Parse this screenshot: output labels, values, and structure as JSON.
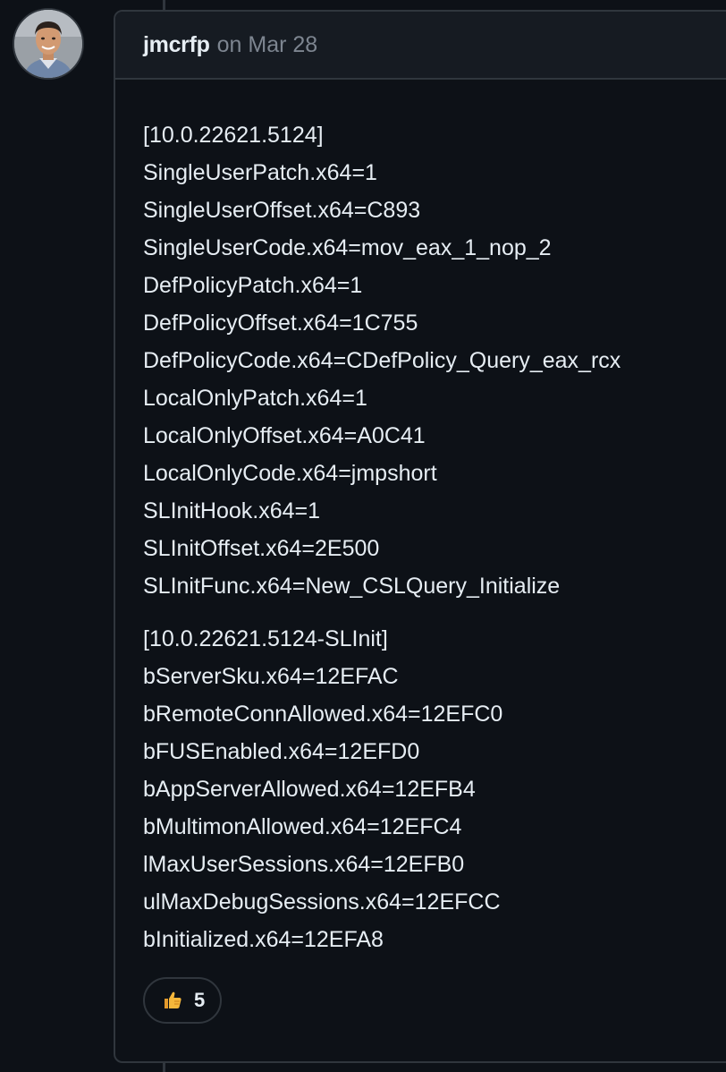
{
  "comment": {
    "author": "jmcrfp",
    "meta": "on Mar 28",
    "avatar_icon": "person-photo-avatar",
    "paragraphs": [
      {
        "lines": [
          "[10.0.22621.5124]",
          "SingleUserPatch.x64=1",
          "SingleUserOffset.x64=C893",
          "SingleUserCode.x64=mov_eax_1_nop_2",
          "DefPolicyPatch.x64=1",
          "DefPolicyOffset.x64=1C755",
          "DefPolicyCode.x64=CDefPolicy_Query_eax_rcx",
          "LocalOnlyPatch.x64=1",
          "LocalOnlyOffset.x64=A0C41",
          "LocalOnlyCode.x64=jmpshort",
          "SLInitHook.x64=1",
          "SLInitOffset.x64=2E500",
          "SLInitFunc.x64=New_CSLQuery_Initialize"
        ]
      },
      {
        "lines": [
          "[10.0.22621.5124-SLInit]",
          "bServerSku.x64=12EFAC",
          "bRemoteConnAllowed.x64=12EFC0",
          "bFUSEnabled.x64=12EFD0",
          "bAppServerAllowed.x64=12EFB4",
          "bMultimonAllowed.x64=12EFC4",
          "lMaxUserSessions.x64=12EFB0",
          "ulMaxDebugSessions.x64=12EFCC",
          "bInitialized.x64=12EFA8"
        ]
      }
    ],
    "reactions": [
      {
        "icon": "thumbs-up-icon",
        "count": "5"
      }
    ]
  },
  "colors": {
    "background": "#0d1117",
    "header_bg": "#161b22",
    "border": "#30363d",
    "text": "#e6edf3",
    "muted": "#7d8590",
    "thumb": "#f5b73b"
  }
}
